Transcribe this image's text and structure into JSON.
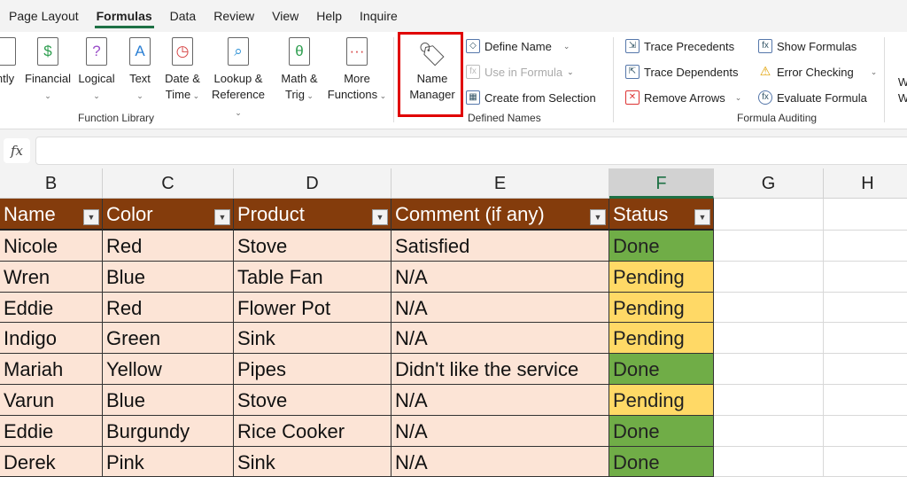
{
  "tabs": [
    "Page Layout",
    "Formulas",
    "Data",
    "Review",
    "View",
    "Help",
    "Inquire"
  ],
  "active_tab": 1,
  "function_library": {
    "group": "Function Library",
    "partial_label": "ntly",
    "buttons": [
      {
        "l1": "Financial",
        "l2": "",
        "icon": "financial-icon",
        "glyph": "$",
        "color": "#2e9e4f"
      },
      {
        "l1": "Logical",
        "l2": "",
        "icon": "logical-icon",
        "glyph": "?",
        "color": "#9b4fc9"
      },
      {
        "l1": "Text",
        "l2": "",
        "icon": "text-icon",
        "glyph": "A",
        "color": "#2a7fd4"
      },
      {
        "l1": "Date &",
        "l2": "Time",
        "icon": "clock-icon",
        "glyph": "◷",
        "color": "#d64545"
      },
      {
        "l1": "Lookup &",
        "l2": "Reference",
        "icon": "lookup-icon",
        "glyph": "⌕",
        "color": "#2a8fd4"
      },
      {
        "l1": "Math &",
        "l2": "Trig",
        "icon": "math-icon",
        "glyph": "θ",
        "color": "#2e9e4f"
      },
      {
        "l1": "More",
        "l2": "Functions",
        "icon": "more-functions-icon",
        "glyph": "···",
        "color": "#d64545"
      }
    ]
  },
  "defined_names": {
    "group": "Defined Names",
    "name_manager_l1": "Name",
    "name_manager_l2": "Manager",
    "define_name": "Define Name",
    "use_in_formula": "Use in Formula",
    "create_from_selection": "Create from Selection"
  },
  "formula_auditing": {
    "group": "Formula Auditing",
    "trace_precedents": "Trace Precedents",
    "trace_dependents": "Trace Dependents",
    "remove_arrows": "Remove Arrows",
    "show_formulas": "Show Formulas",
    "error_checking": "Error Checking",
    "evaluate_formula": "Evaluate Formula",
    "partial_w1": "W",
    "partial_w2": "W"
  },
  "formula_bar": {
    "fx": "fx",
    "value": ""
  },
  "columns": [
    "B",
    "C",
    "D",
    "E",
    "F",
    "G",
    "H"
  ],
  "selected_column": "F",
  "table": {
    "headers": [
      "Name",
      "Color",
      "Product",
      "Comment (if any)",
      "Status"
    ],
    "rows": [
      [
        "Nicole",
        "Red",
        "Stove",
        "Satisfied",
        "Done"
      ],
      [
        "Wren",
        "Blue",
        "Table Fan",
        "N/A",
        "Pending"
      ],
      [
        "Eddie",
        "Red",
        "Flower Pot",
        "N/A",
        "Pending"
      ],
      [
        "Indigo",
        "Green",
        "Sink",
        "N/A",
        "Pending"
      ],
      [
        "Mariah",
        "Yellow",
        "Pipes",
        "Didn't like the service",
        "Done"
      ],
      [
        "Varun",
        "Blue",
        "Stove",
        "N/A",
        "Pending"
      ],
      [
        "Eddie",
        "Burgundy",
        "Rice Cooker",
        "N/A",
        "Done"
      ],
      [
        "Derek",
        "Pink",
        "Sink",
        "N/A",
        "Done"
      ]
    ]
  },
  "colors": {
    "header": "#843c0c",
    "cell": "#fce4d6",
    "done": "#70ad47",
    "pending": "#ffd966",
    "highlight": "#e00000"
  }
}
